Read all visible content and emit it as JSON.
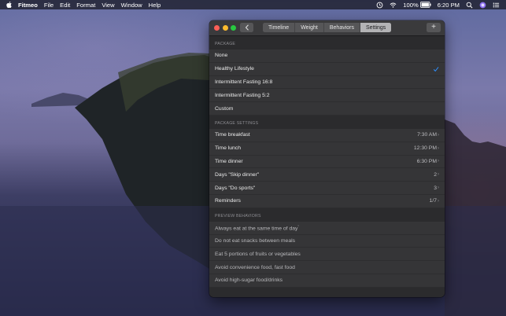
{
  "menubar": {
    "app_name": "Fitmeo",
    "menus": [
      "File",
      "Edit",
      "Format",
      "View",
      "Window",
      "Help"
    ],
    "battery": "100%",
    "time": "6:20 PM",
    "icons": [
      "apple-logo",
      "time-machine-icon",
      "wifi-icon",
      "battery-icon",
      "spotlight-search-icon",
      "siri-icon",
      "notification-center-icon"
    ]
  },
  "window": {
    "tabs": [
      {
        "label": "Timeline",
        "active": false
      },
      {
        "label": "Weight",
        "active": false
      },
      {
        "label": "Behaviors",
        "active": false
      },
      {
        "label": "Settings",
        "active": true
      }
    ],
    "add_label": "+",
    "package": {
      "header": "PACKAGE",
      "options": [
        {
          "label": "None",
          "selected": false
        },
        {
          "label": "Healthy Lifestyle",
          "selected": true
        },
        {
          "label": "Intermittent Fasting 16:8",
          "selected": false
        },
        {
          "label": "Intermittent Fasting 5:2",
          "selected": false
        },
        {
          "label": "Custom",
          "selected": false
        }
      ]
    },
    "package_settings": {
      "header": "PACKAGE SETTINGS",
      "rows": [
        {
          "label": "Time breakfast",
          "value": "7:30 AM"
        },
        {
          "label": "Time lunch",
          "value": "12:30 PM"
        },
        {
          "label": "Time dinner",
          "value": "6:30 PM"
        },
        {
          "label": "Days \"Skip dinner\"",
          "value": "2"
        },
        {
          "label": "Days \"Do sports\"",
          "value": "3"
        },
        {
          "label": "Reminders",
          "value": "1/7"
        }
      ]
    },
    "preview_behaviors": {
      "header": "PREVIEW BEHAVIORS",
      "items": [
        {
          "label": "Always eat at the same time of day",
          "mark": "¹"
        },
        {
          "label": "Do not eat snacks between meals",
          "mark": ""
        },
        {
          "label": "Eat 5 portions of fruits or vegetables",
          "mark": ""
        },
        {
          "label": "Avoid convenience food, fast food",
          "mark": ""
        },
        {
          "label": "Avoid high-sugar food/drinks",
          "mark": ""
        }
      ]
    },
    "colors": {
      "accent_check": "#2e8fff",
      "selected_tab": "#b3b3b5",
      "close": "#fe5f57",
      "minimize": "#febc2e",
      "zoom": "#28c840"
    }
  }
}
